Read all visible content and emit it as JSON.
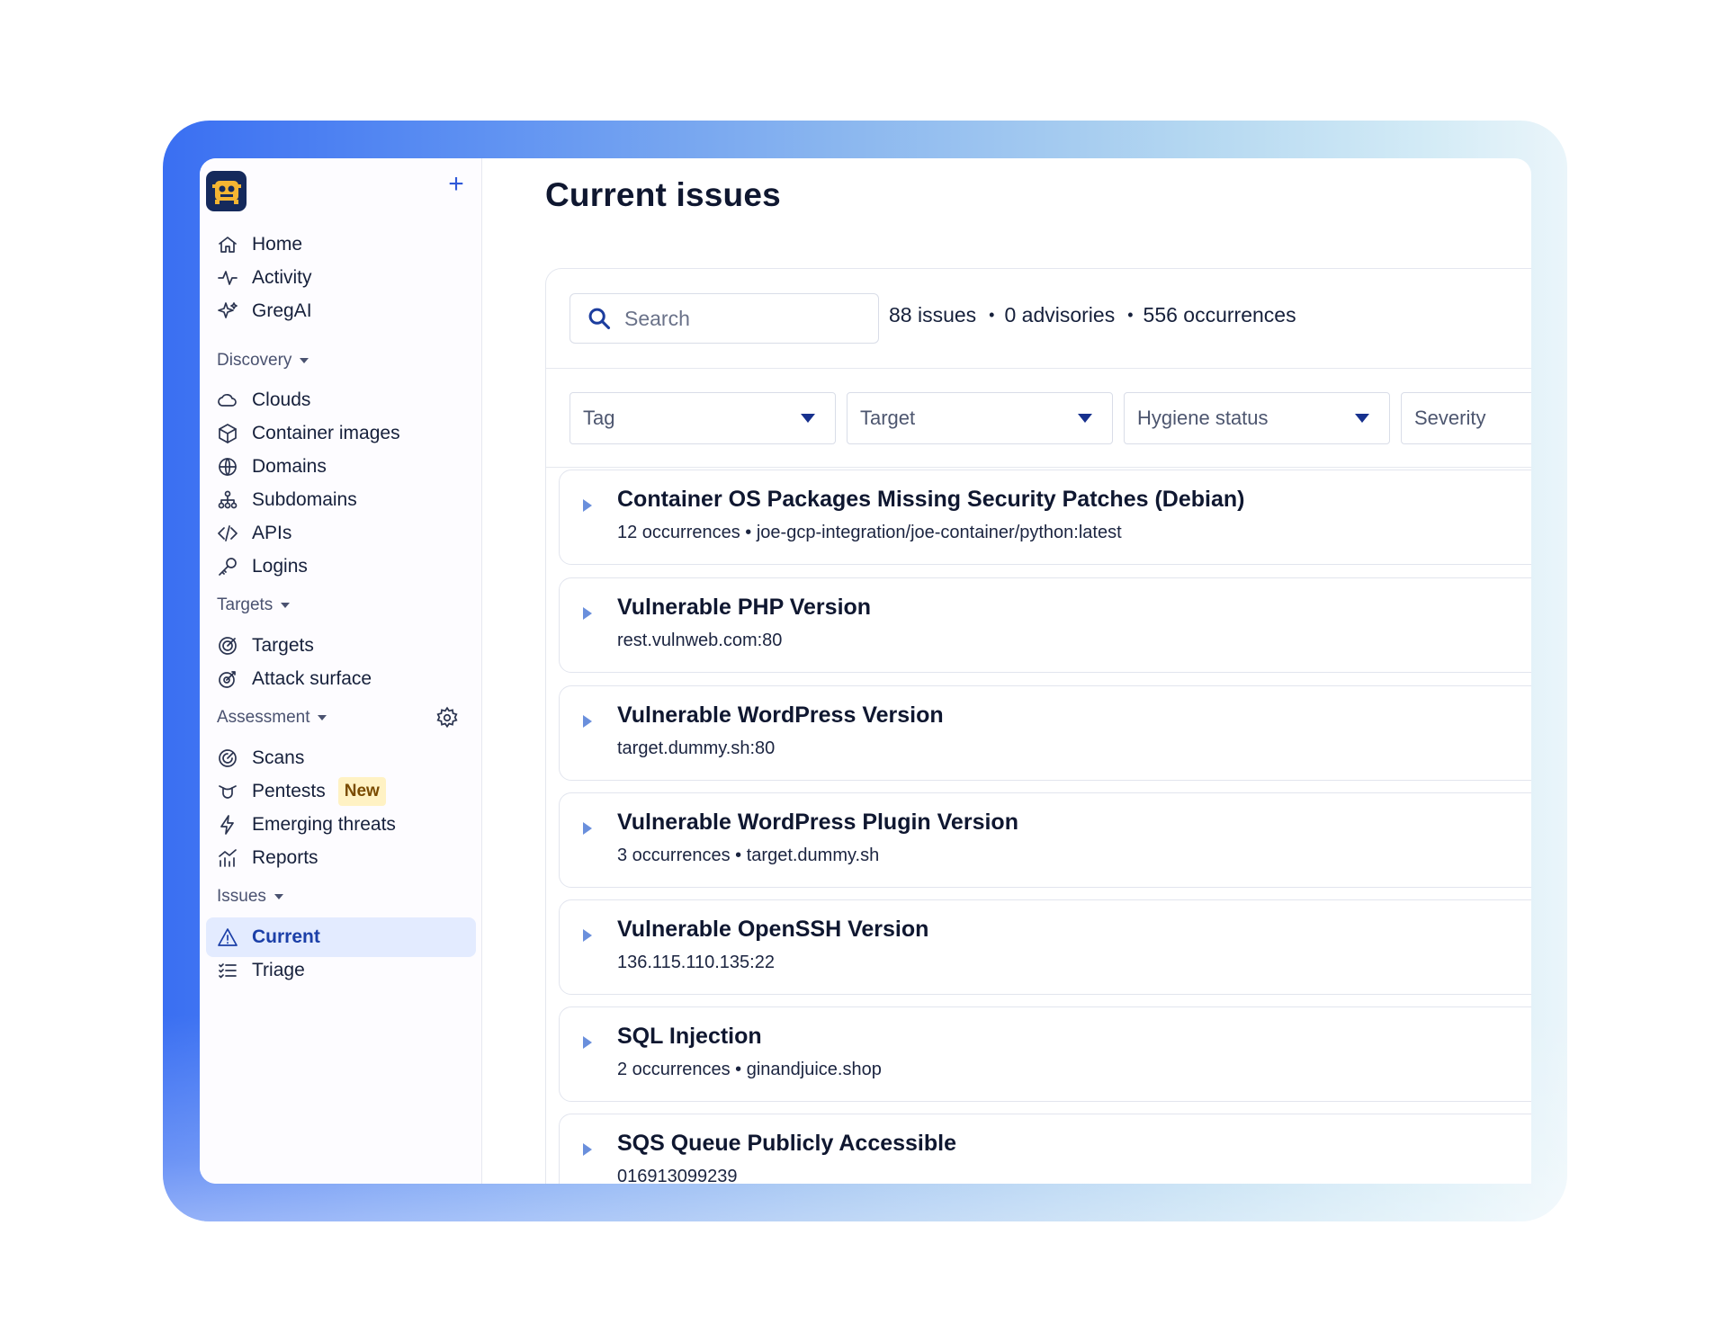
{
  "sidebar": {
    "plus_label": "+",
    "items": [
      {
        "label": "Home"
      },
      {
        "label": "Activity"
      },
      {
        "label": "GregAI"
      }
    ],
    "sections": {
      "discovery": {
        "label": "Discovery",
        "items": [
          {
            "label": "Clouds"
          },
          {
            "label": "Container images"
          },
          {
            "label": "Domains"
          },
          {
            "label": "Subdomains"
          },
          {
            "label": "APIs"
          },
          {
            "label": "Logins"
          }
        ]
      },
      "targets": {
        "label": "Targets",
        "items": [
          {
            "label": "Targets"
          },
          {
            "label": "Attack surface"
          }
        ]
      },
      "assessment": {
        "label": "Assessment",
        "items": [
          {
            "label": "Scans"
          },
          {
            "label": "Pentests",
            "badge": "New"
          },
          {
            "label": "Emerging threats"
          },
          {
            "label": "Reports"
          }
        ]
      },
      "issues": {
        "label": "Issues",
        "items": [
          {
            "label": "Current",
            "active": true
          },
          {
            "label": "Triage"
          }
        ]
      }
    }
  },
  "main": {
    "title": "Current issues",
    "search_placeholder": "Search",
    "stats": {
      "issues": "88 issues",
      "advisories": "0 advisories",
      "occurrences": "556 occurrences",
      "separator": "•"
    },
    "filters": [
      {
        "label": "Tag"
      },
      {
        "label": "Target"
      },
      {
        "label": "Hygiene status"
      },
      {
        "label": "Severity"
      }
    ],
    "issues": [
      {
        "title": "Container OS Packages Missing Security Patches (Debian)",
        "subtitle": "12 occurrences • joe-gcp-integration/joe-container/python:latest"
      },
      {
        "title": "Vulnerable PHP Version",
        "subtitle": "rest.vulnweb.com:80"
      },
      {
        "title": "Vulnerable WordPress Version",
        "subtitle": "target.dummy.sh:80"
      },
      {
        "title": "Vulnerable WordPress Plugin Version",
        "subtitle": "3 occurrences • target.dummy.sh"
      },
      {
        "title": "Vulnerable OpenSSH Version",
        "subtitle": "136.115.110.135:22"
      },
      {
        "title": "SQL Injection",
        "subtitle": "2 occurrences • ginandjuice.shop"
      },
      {
        "title": "SQS Queue Publicly Accessible",
        "subtitle": "016913099239"
      }
    ]
  },
  "colors": {
    "accent": "#2f58d9",
    "active_bg": "#e3ebff",
    "badge_bg": "#fff2c4",
    "filter_caret": "#17318e"
  }
}
